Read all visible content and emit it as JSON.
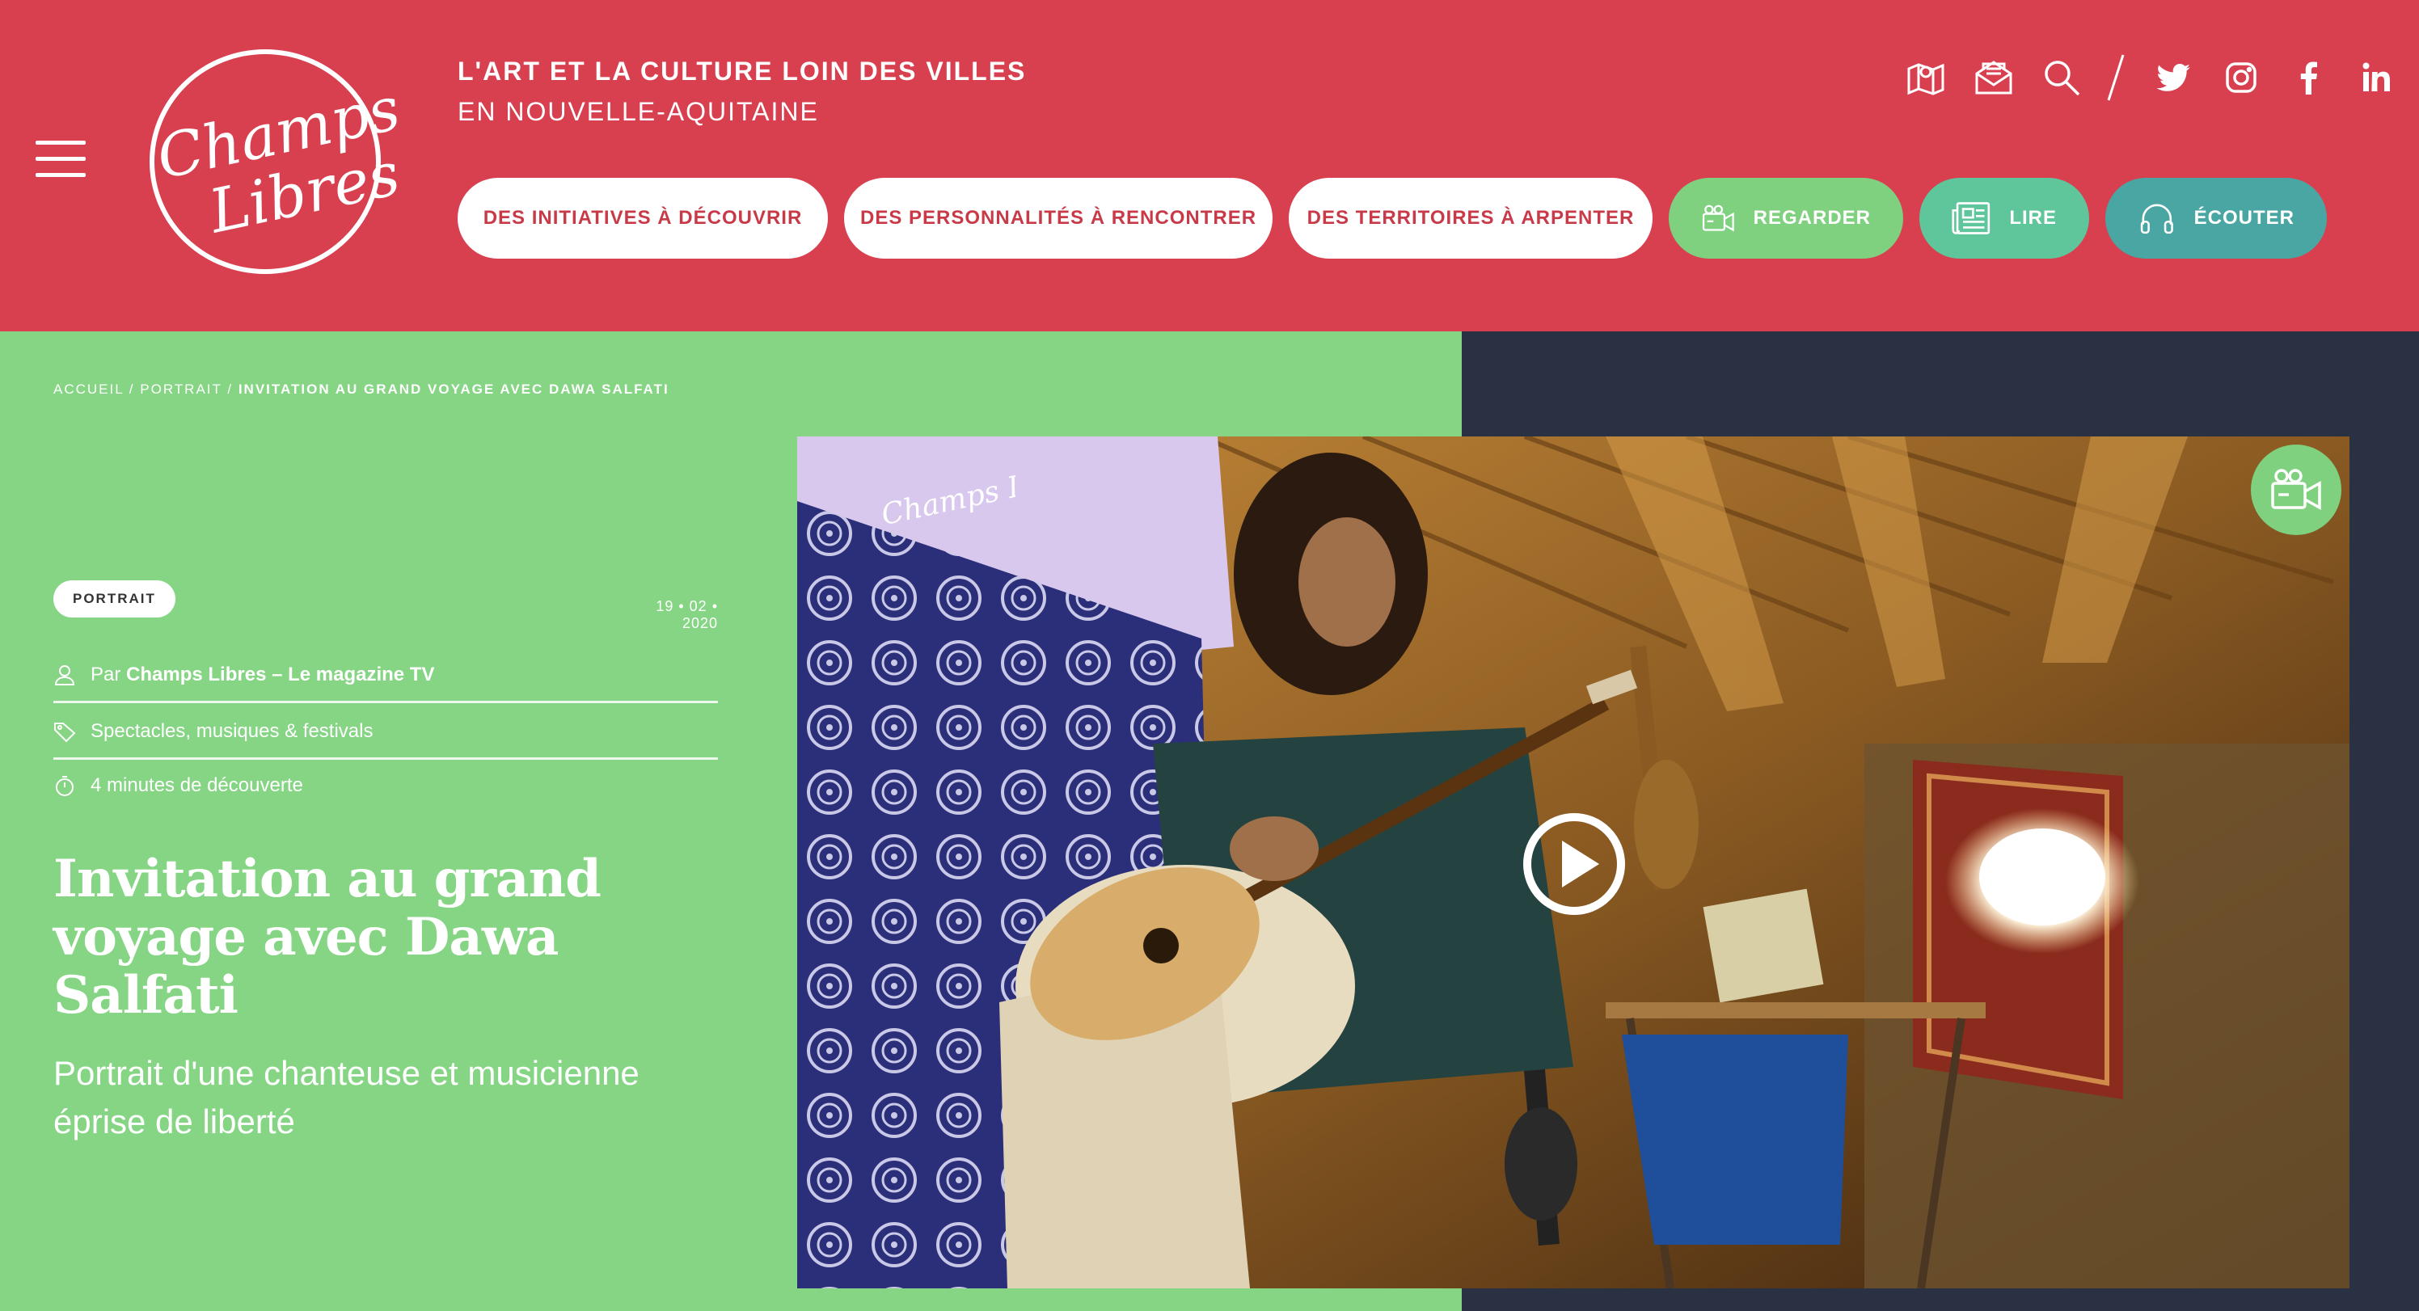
{
  "header": {
    "tagline_line1": "L'ART ET LA CULTURE LOIN DES VILLES",
    "tagline_line2": "EN NOUVELLE-AQUITAINE",
    "logo_text": "Champs Libres",
    "icons": [
      "map-icon",
      "newsletter-icon",
      "search-icon",
      "twitter-icon",
      "instagram-icon",
      "facebook-icon",
      "linkedin-icon"
    ]
  },
  "nav": {
    "initiatives": "DES INITIATIVES À DÉCOUVRIR",
    "personnalites": "DES PERSONNALITÉS À RENCONTRER",
    "territoires": "DES TERRITOIRES À ARPENTER",
    "regarder": "REGARDER",
    "lire": "LIRE",
    "ecouter": "ÉCOUTER"
  },
  "colors": {
    "header_red": "#d83f4f",
    "green_panel": "#85d584",
    "regarder_green": "#7fd07f",
    "lire_teal": "#5fc59a",
    "ecouter_blue": "#4aa6a3",
    "dark_panel": "#2a3142"
  },
  "breadcrumb": {
    "home": "ACCUEIL",
    "sep": "/",
    "section": "PORTRAIT",
    "current": "INVITATION AU GRAND VOYAGE AVEC DAWA SALFATI"
  },
  "article": {
    "badge": "PORTRAIT",
    "date": "19 • 02 • 2020",
    "author_prefix": "Par",
    "author": "Champs Libres – Le magazine TV",
    "category": "Spectacles, musiques & festivals",
    "reading_time": "4 minutes de découverte",
    "title": "Invitation au grand voyage avec Dawa Salfati",
    "subtitle": "Portrait d'une chanteuse et musicienne éprise de liberté"
  },
  "video": {
    "watermark": "Champs Libres"
  }
}
